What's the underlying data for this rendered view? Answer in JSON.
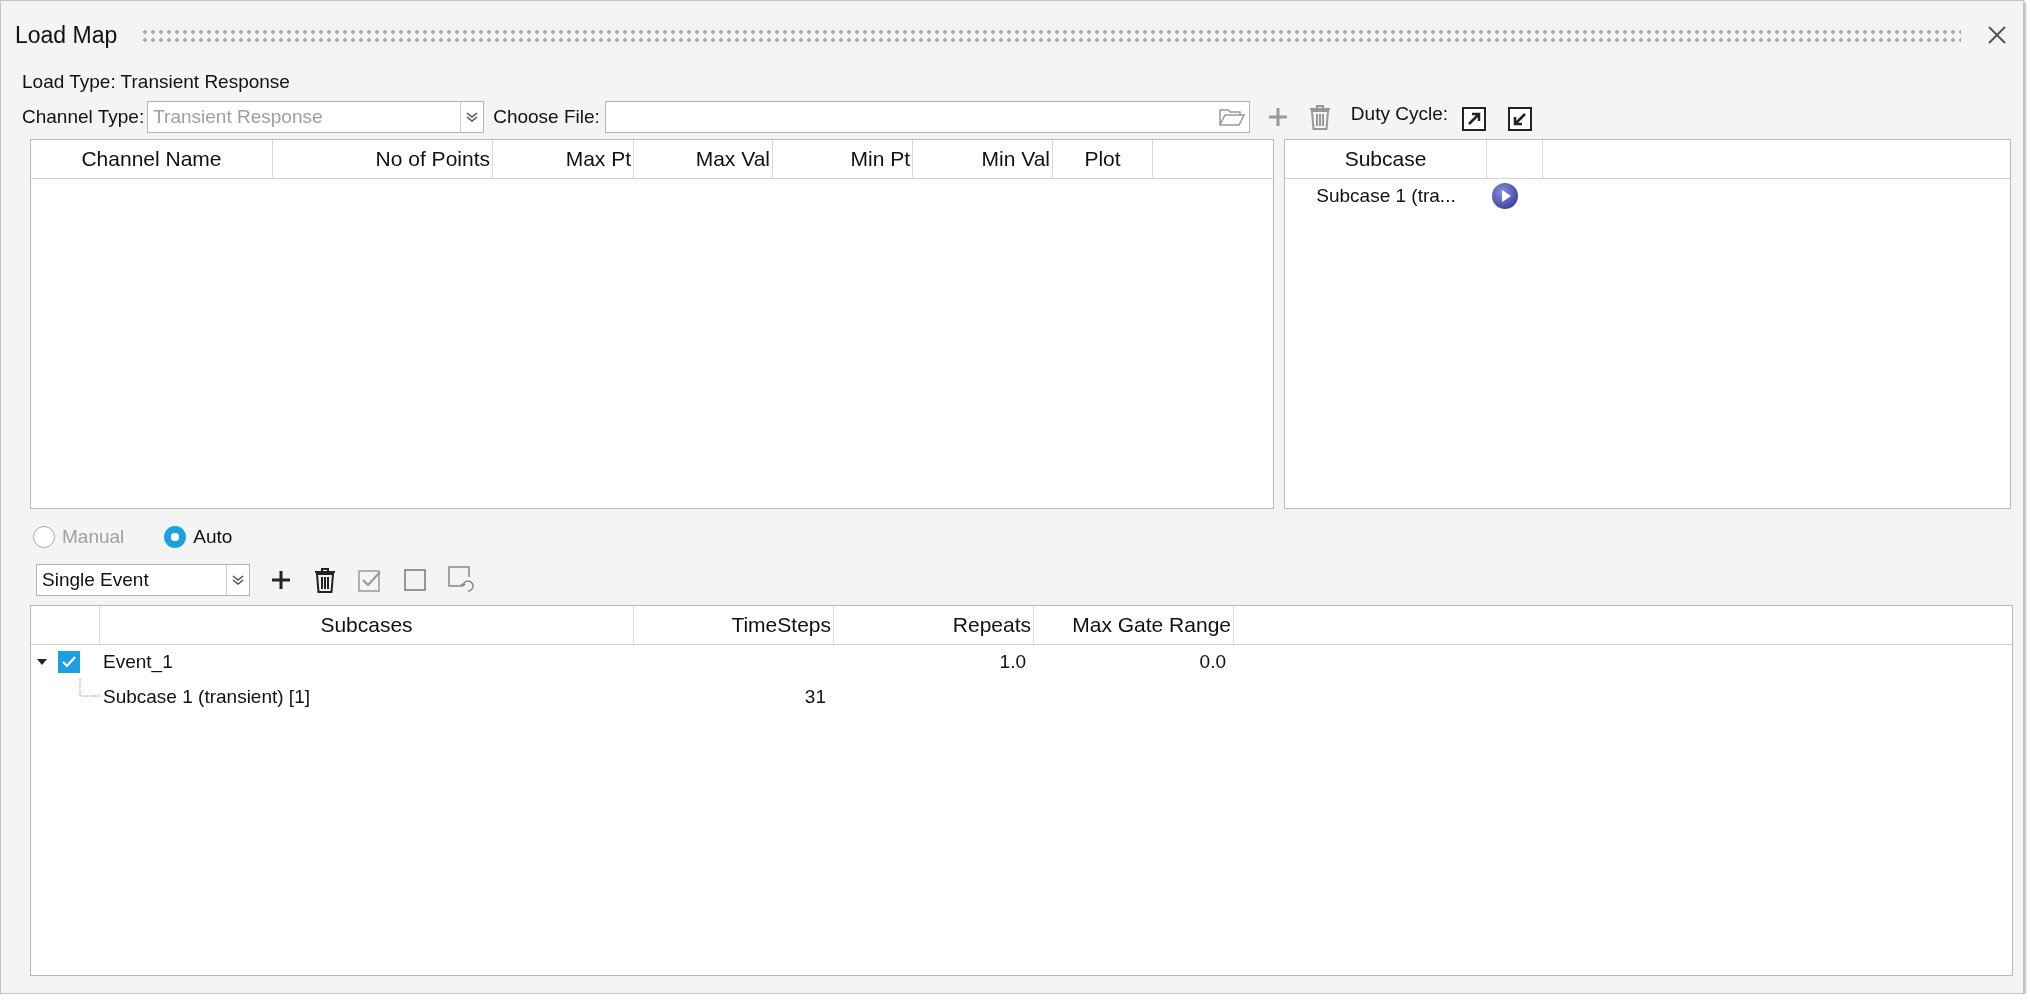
{
  "window": {
    "title": "Load Map"
  },
  "load_type": "Load Type: Transient Response",
  "channel_type": {
    "label": "Channel Type:",
    "value": "Transient Response",
    "disabled": true
  },
  "choose_file": {
    "label": "Choose File:"
  },
  "duty_cycle": {
    "label": "Duty Cycle:"
  },
  "channel_table": {
    "columns": [
      "Channel Name",
      "No of Points",
      "Max Pt",
      "Max Val",
      "Min Pt",
      "Min Val",
      "Plot"
    ]
  },
  "subcase_table": {
    "columns": [
      "Subcase"
    ],
    "rows": [
      {
        "name": "Subcase 1 (tra..."
      }
    ]
  },
  "mode": [
    {
      "label": "Manual",
      "selected": false,
      "disabled": true
    },
    {
      "label": "Auto",
      "selected": true,
      "disabled": false
    }
  ],
  "event_type": {
    "value": "Single Event"
  },
  "events_table": {
    "columns": [
      "Subcases",
      "TimeSteps",
      "Repeats",
      "Max Gate Range"
    ],
    "rows": [
      {
        "name": "Event_1",
        "checked": true,
        "expanded": true,
        "repeats": "1.0",
        "max_gate_range": "0.0",
        "children": [
          {
            "name": "Subcase 1 (transient) [1]",
            "timesteps": "31"
          }
        ]
      }
    ]
  }
}
